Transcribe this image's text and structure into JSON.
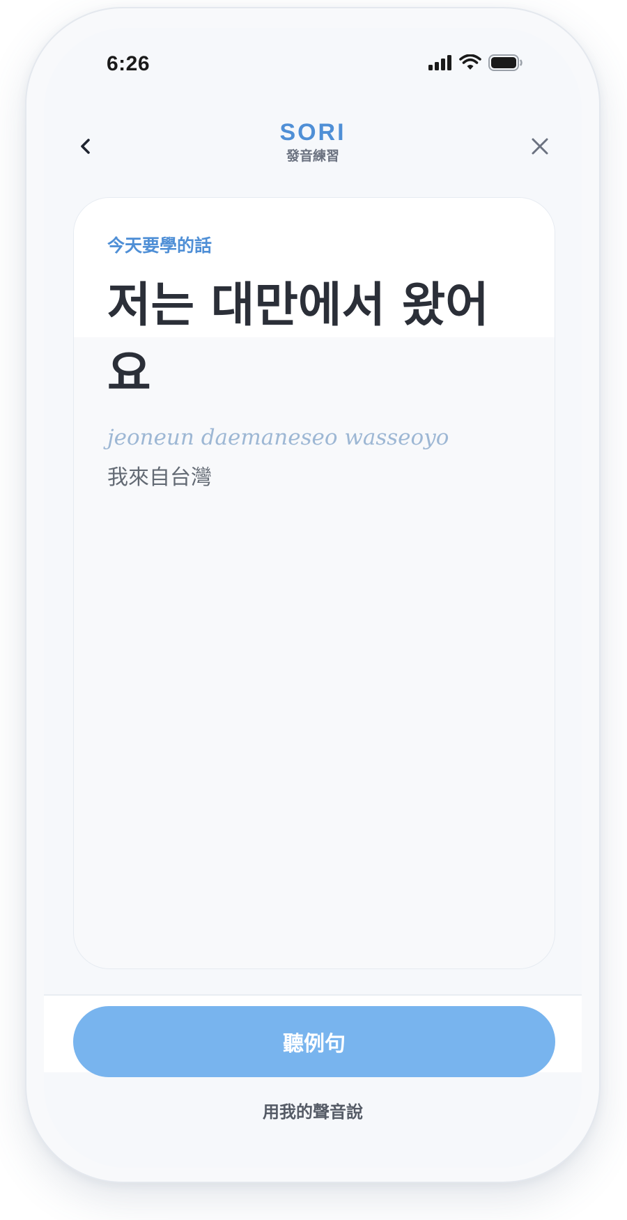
{
  "status_bar": {
    "time": "6:26",
    "icons": [
      "cellular-signal-icon",
      "wifi-icon",
      "battery-icon"
    ]
  },
  "nav": {
    "back_icon": "chevron-left-icon",
    "close_icon": "close-icon",
    "title": "SORI",
    "subtitle": "發音練習"
  },
  "card": {
    "label": "今天要學的話",
    "korean": "저는 대만에서 왔어요",
    "romanization": "jeoneun daemaneseo wasseoyo",
    "translation": "我來自台灣"
  },
  "actions": {
    "listen_label": "聽例句",
    "speak_label": "用我的聲音說"
  },
  "colors": {
    "accent": "#4f8fd6",
    "button": "#78b4ee",
    "heading": "#2b2f38",
    "romanization": "#9db7d4"
  }
}
